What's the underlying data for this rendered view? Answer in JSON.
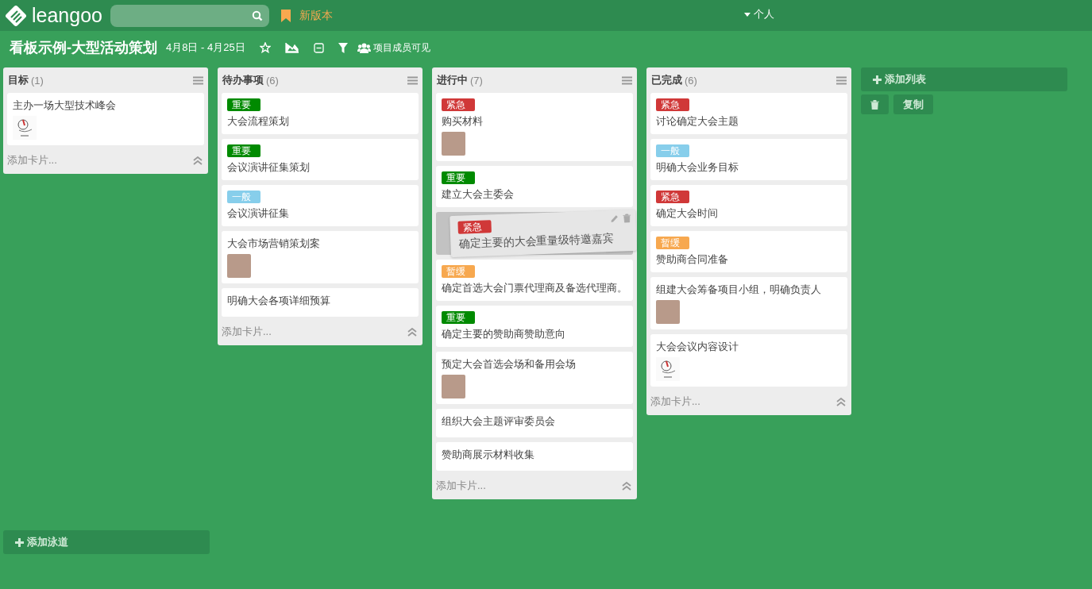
{
  "topbar": {
    "logo_text": "leangoo",
    "new_version": "新版本",
    "user_menu": "个人"
  },
  "board": {
    "title": "看板示例-大型活动策划",
    "dates": "4月8日 - 4月25日",
    "visibility": "项目成员可见"
  },
  "lists": [
    {
      "title": "目标",
      "count": "(1)",
      "add_card": "添加卡片...",
      "cards": [
        {
          "kind": "card",
          "text": "主办一场大型技术峰会",
          "avatar": {
            "kind": "logo"
          }
        }
      ]
    },
    {
      "title": "待办事项",
      "count": "(6)",
      "add_card": "添加卡片...",
      "cards": [
        {
          "kind": "card",
          "tag": {
            "text": "重要",
            "color": "#008a00"
          },
          "text": "大会流程策划"
        },
        {
          "kind": "card",
          "tag": {
            "text": "重要",
            "color": "#008a00"
          },
          "text": "会议演讲征集策划"
        },
        {
          "kind": "card",
          "tag": {
            "text": "一般",
            "color": "#87ceeb"
          },
          "text": "会议演讲征集"
        },
        {
          "kind": "card",
          "text": "大会市场营销策划案",
          "avatar": {
            "kind": "photo"
          }
        },
        {
          "kind": "card",
          "text": "明确大会各项详细预算"
        }
      ]
    },
    {
      "title": "进行中",
      "count": "(7)",
      "add_card": "添加卡片...",
      "cards": [
        {
          "kind": "card",
          "tag": {
            "text": "紧急",
            "color": "#d03838"
          },
          "text": "购买材料",
          "avatar": {
            "kind": "photo"
          }
        },
        {
          "kind": "card",
          "tag": {
            "text": "重要",
            "color": "#008a00"
          },
          "text": "建立大会主委会"
        },
        {
          "kind": "placeholder",
          "dragged": {
            "tag": {
              "text": "紧急",
              "color": "#d03838"
            },
            "text": "确定主要的大会重量级特邀嘉宾"
          }
        },
        {
          "kind": "card",
          "tag": {
            "text": "暂缓",
            "color": "#f7a84f"
          },
          "text": "确定首选大会门票代理商及备选代理商。"
        },
        {
          "kind": "card",
          "tag": {
            "text": "重要",
            "color": "#008a00"
          },
          "text": "确定主要的赞助商赞助意向"
        },
        {
          "kind": "card",
          "text": "预定大会首选会场和备用会场",
          "avatar": {
            "kind": "photo"
          }
        },
        {
          "kind": "card",
          "text": "组织大会主题评审委员会"
        },
        {
          "kind": "card",
          "text": "赞助商展示材料收集"
        }
      ]
    },
    {
      "title": "已完成",
      "count": "(6)",
      "add_card": "添加卡片...",
      "cards": [
        {
          "kind": "card",
          "tag": {
            "text": "紧急",
            "color": "#d03838"
          },
          "text": "讨论确定大会主题"
        },
        {
          "kind": "card",
          "tag": {
            "text": "一般",
            "color": "#87ceeb"
          },
          "text": "明确大会业务目标"
        },
        {
          "kind": "card",
          "tag": {
            "text": "紧急",
            "color": "#d03838"
          },
          "text": "确定大会时间"
        },
        {
          "kind": "card",
          "tag": {
            "text": "暂缓",
            "color": "#f7a84f"
          },
          "text": "赞助商合同准备"
        },
        {
          "kind": "card",
          "text": "组建大会筹备项目小组，明确负责人",
          "avatar": {
            "kind": "photo"
          }
        },
        {
          "kind": "card",
          "text": "大会会议内容设计",
          "avatar": {
            "kind": "logo"
          }
        }
      ]
    }
  ],
  "add_list": "添加列表",
  "copy_button": "复制",
  "add_swimlane": "添加泳道"
}
